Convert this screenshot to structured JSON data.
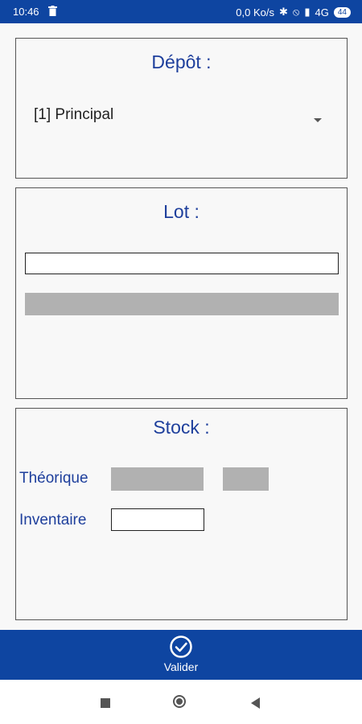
{
  "status_bar": {
    "time": "10:46",
    "network_speed": "0,0 Ko/s",
    "signal": "4G",
    "battery": "44"
  },
  "depot": {
    "title": "Dépôt :",
    "selected": "[1] Principal"
  },
  "lot": {
    "title": "Lot :",
    "input_value": ""
  },
  "stock": {
    "title": "Stock :",
    "theorique_label": "Théorique",
    "inventaire_label": "Inventaire",
    "inventaire_value": ""
  },
  "action_bar": {
    "valider_label": "Valider"
  },
  "colors": {
    "primary": "#0e45a1",
    "title_text": "#1e3f9c",
    "placeholder_gray": "#b1b1b1"
  }
}
